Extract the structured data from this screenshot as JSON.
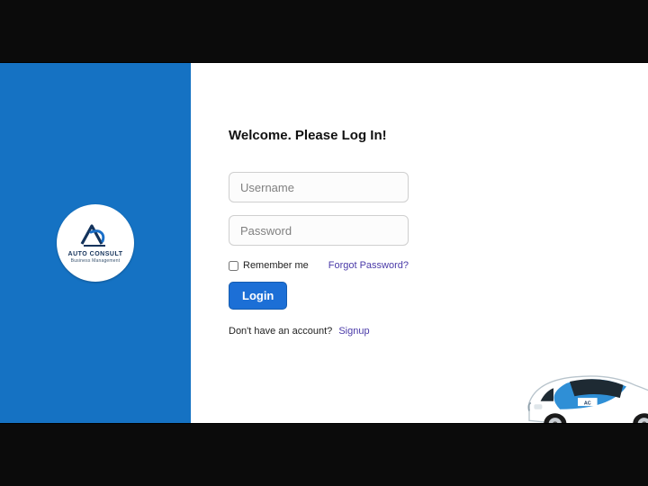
{
  "brand": {
    "name": "AUTO CONSULT",
    "tagline": "Business Management"
  },
  "title": "Welcome. Please Log In!",
  "form": {
    "username_placeholder": "Username",
    "password_placeholder": "Password",
    "remember_label": "Remember me",
    "forgot_label": "Forgot Password?",
    "login_label": "Login"
  },
  "signup": {
    "prompt": "Don't have an account?",
    "link_label": "Signup"
  },
  "colors": {
    "brand_blue": "#1572c3",
    "button_blue": "#1c6fd6",
    "link_purple": "#4a3aa8"
  }
}
